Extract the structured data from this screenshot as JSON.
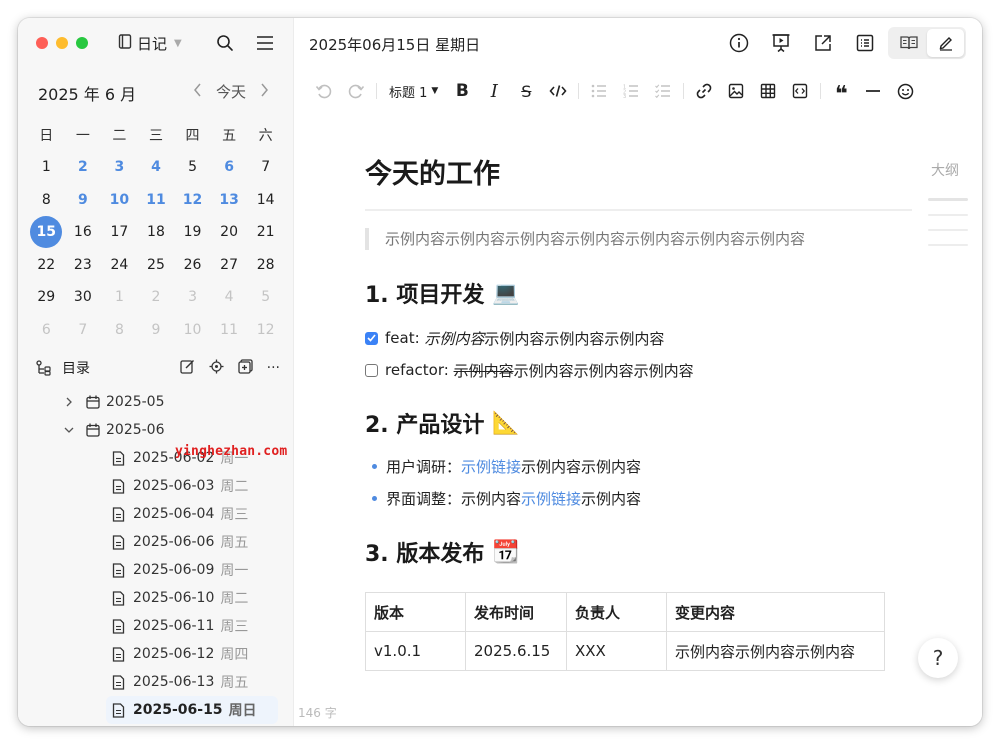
{
  "window": {
    "notebook_label": "日记"
  },
  "calendar": {
    "title": "2025 年 6 月",
    "today_label": "今天",
    "weekdays": [
      "日",
      "一",
      "二",
      "三",
      "四",
      "五",
      "六"
    ],
    "days": [
      {
        "d": "1",
        "t": "n"
      },
      {
        "d": "2",
        "t": "note"
      },
      {
        "d": "3",
        "t": "note"
      },
      {
        "d": "4",
        "t": "note"
      },
      {
        "d": "5",
        "t": "n"
      },
      {
        "d": "6",
        "t": "note"
      },
      {
        "d": "7",
        "t": "n"
      },
      {
        "d": "8",
        "t": "n"
      },
      {
        "d": "9",
        "t": "note"
      },
      {
        "d": "10",
        "t": "note"
      },
      {
        "d": "11",
        "t": "note"
      },
      {
        "d": "12",
        "t": "note"
      },
      {
        "d": "13",
        "t": "note"
      },
      {
        "d": "14",
        "t": "n"
      },
      {
        "d": "15",
        "t": "sel"
      },
      {
        "d": "16",
        "t": "n"
      },
      {
        "d": "17",
        "t": "n"
      },
      {
        "d": "18",
        "t": "n"
      },
      {
        "d": "19",
        "t": "n"
      },
      {
        "d": "20",
        "t": "n"
      },
      {
        "d": "21",
        "t": "n"
      },
      {
        "d": "22",
        "t": "n"
      },
      {
        "d": "23",
        "t": "n"
      },
      {
        "d": "24",
        "t": "n"
      },
      {
        "d": "25",
        "t": "n"
      },
      {
        "d": "26",
        "t": "n"
      },
      {
        "d": "27",
        "t": "n"
      },
      {
        "d": "28",
        "t": "n"
      },
      {
        "d": "29",
        "t": "n"
      },
      {
        "d": "30",
        "t": "n"
      },
      {
        "d": "1",
        "t": "other"
      },
      {
        "d": "2",
        "t": "other"
      },
      {
        "d": "3",
        "t": "other"
      },
      {
        "d": "4",
        "t": "other"
      },
      {
        "d": "5",
        "t": "other"
      },
      {
        "d": "6",
        "t": "other"
      },
      {
        "d": "7",
        "t": "other"
      },
      {
        "d": "8",
        "t": "other"
      },
      {
        "d": "9",
        "t": "other"
      },
      {
        "d": "10",
        "t": "other"
      },
      {
        "d": "11",
        "t": "other"
      },
      {
        "d": "12",
        "t": "other"
      }
    ]
  },
  "toc": {
    "label": "目录",
    "folders": [
      {
        "name": "2025-05",
        "expanded": false
      },
      {
        "name": "2025-06",
        "expanded": true
      }
    ],
    "files": [
      {
        "date": "2025-06-02",
        "weekday": "周一"
      },
      {
        "date": "2025-06-03",
        "weekday": "周二"
      },
      {
        "date": "2025-06-04",
        "weekday": "周三"
      },
      {
        "date": "2025-06-06",
        "weekday": "周五"
      },
      {
        "date": "2025-06-09",
        "weekday": "周一"
      },
      {
        "date": "2025-06-10",
        "weekday": "周二"
      },
      {
        "date": "2025-06-11",
        "weekday": "周三"
      },
      {
        "date": "2025-06-12",
        "weekday": "周四"
      },
      {
        "date": "2025-06-13",
        "weekday": "周五"
      },
      {
        "date": "2025-06-15",
        "weekday": "周日",
        "selected": true
      }
    ],
    "watermark": "yinghezhan.com"
  },
  "header": {
    "date_title": "2025年06月15日 星期日"
  },
  "toolbar": {
    "heading_select": "标题 1"
  },
  "doc": {
    "title": "今天的工作",
    "quote": "示例内容示例内容示例内容示例内容示例内容示例内容示例内容",
    "s1": {
      "title": "1. 项目开发",
      "emoji": "💻"
    },
    "task1": {
      "prefix": "feat: ",
      "italic": "示例内容",
      "rest": "示例内容示例内容示例内容",
      "checked": true
    },
    "task2": {
      "prefix": "refactor: ",
      "strike": "示例内容",
      "rest": "示例内容示例内容示例内容",
      "checked": false
    },
    "s2": {
      "title": "2. 产品设计",
      "emoji": "📐"
    },
    "b1": {
      "label": "用户调研：",
      "link": "示例链接",
      "rest": "示例内容示例内容"
    },
    "b2": {
      "label": "界面调整：",
      "pre": "示例内容",
      "link": "示例链接",
      "rest": "示例内容"
    },
    "s3": {
      "title": "3. 版本发布",
      "emoji": "📆"
    },
    "table": {
      "headers": [
        "版本",
        "发布时间",
        "负责人",
        "变更内容"
      ],
      "rows": [
        [
          "v1.0.1",
          "2025.6.15",
          "XXX",
          "示例内容示例内容示例内容"
        ]
      ]
    }
  },
  "outline": {
    "label": "大纲"
  },
  "status": {
    "word_count": "146 字"
  },
  "help": {
    "label": "?"
  }
}
